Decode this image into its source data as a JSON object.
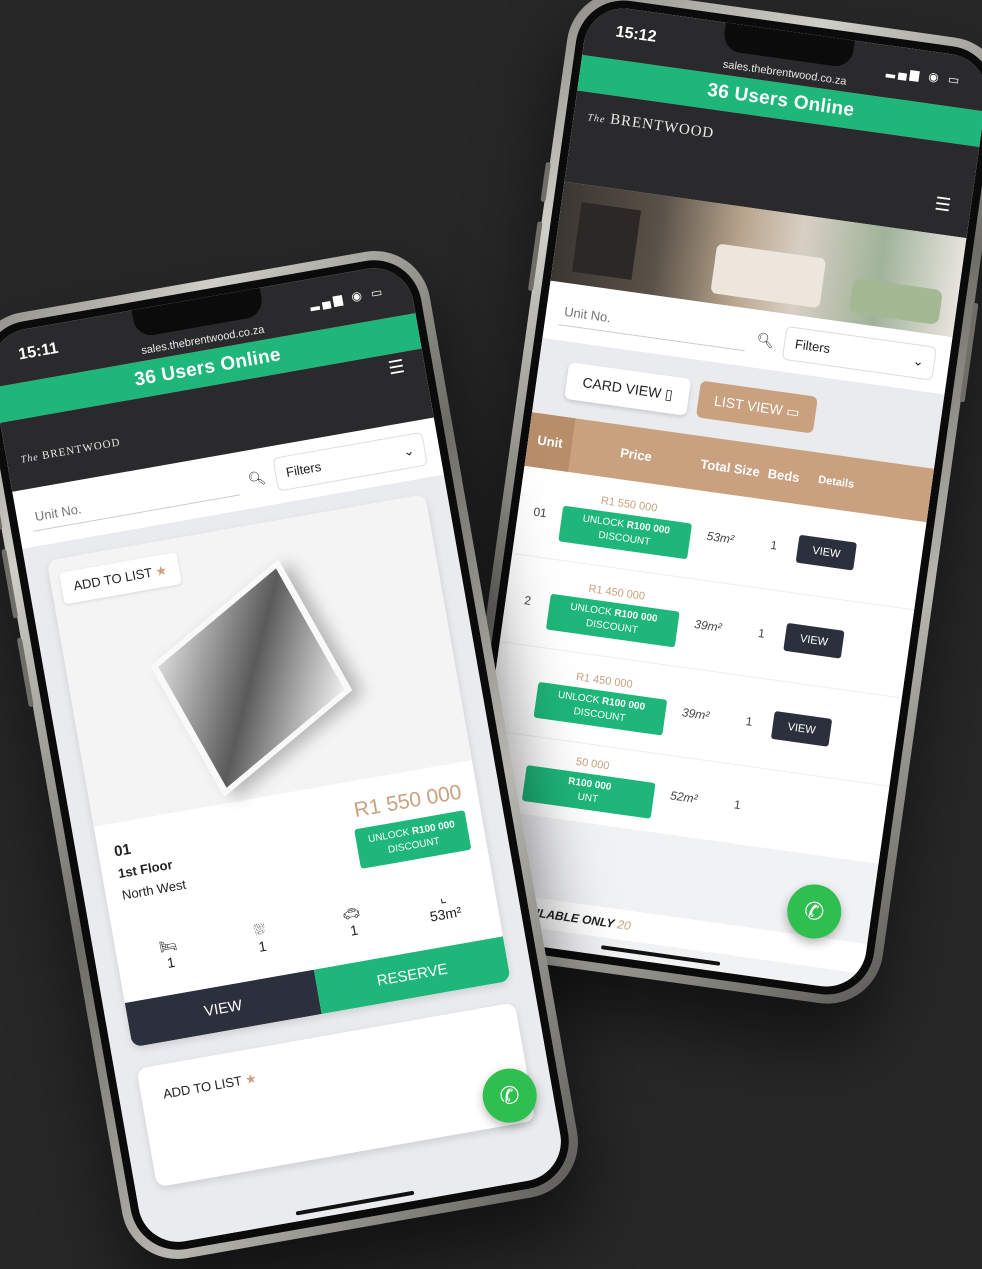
{
  "colors": {
    "background": "#272727",
    "accent_green": "#1eb679",
    "accent_tan": "#c9a17f",
    "navy": "#2c2f3c",
    "header_dark": "#2a292b"
  },
  "right_phone": {
    "time": "15:12",
    "url": "sales.thebrentwood.co.za",
    "online_banner": "36 Users Online",
    "brand_prefix": "The",
    "brand": "BRENTWOOD",
    "search_placeholder": "Unit No.",
    "filters_label": "Filters",
    "card_view_label": "CARD VIEW",
    "list_view_label": "LIST VIEW",
    "table_headers": [
      "Unit",
      "Price",
      "Total Size",
      "Beds",
      "Details"
    ],
    "rows": [
      {
        "unit": "01",
        "price": "R1 550 000",
        "unlock": "UNLOCK",
        "amount": "R100 000",
        "discount": "DISCOUNT",
        "size": "53m²",
        "beds": "1",
        "action": "VIEW"
      },
      {
        "unit": "2",
        "price": "R1 450 000",
        "unlock": "UNLOCK",
        "amount": "R100 000",
        "discount": "DISCOUNT",
        "size": "39m²",
        "beds": "1",
        "action": "VIEW"
      },
      {
        "unit": "",
        "price": "R1 450 000",
        "unlock": "UNLOCK",
        "amount": "R100 000",
        "discount": "DISCOUNT",
        "size": "39m²",
        "beds": "1",
        "action": "VIEW"
      },
      {
        "unit": "",
        "price": "50 000",
        "unlock": "",
        "amount": "R100 000",
        "discount": "UNT",
        "size": "52m²",
        "beds": "1",
        "action": ""
      }
    ],
    "footer_total": "20",
    "footer_available_label": "AVAILABLE ONLY",
    "footer_available_count": "20"
  },
  "left_phone": {
    "time": "15:11",
    "url": "sales.thebrentwood.co.za",
    "online_banner": "36 Users Online",
    "brand_prefix": "The",
    "brand": "BRENTWOOD",
    "search_placeholder": "Unit No.",
    "filters_label": "Filters",
    "add_to_list": "ADD TO LIST",
    "unit_number": "01",
    "floor": "1st Floor",
    "orientation": "North West",
    "price": "R1 550 000",
    "unlock": "UNLOCK",
    "amount": "R100 000",
    "discount": "DISCOUNT",
    "beds": "1",
    "baths": "1",
    "parking": "1",
    "size": "53m²",
    "view_label": "VIEW",
    "reserve_label": "RESERVE",
    "add_to_list_2": "ADD TO LIST"
  }
}
